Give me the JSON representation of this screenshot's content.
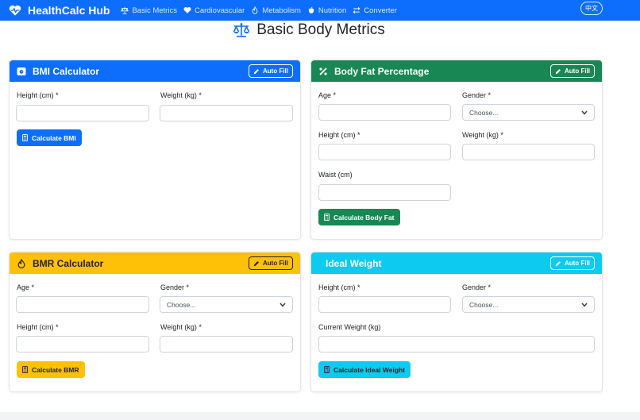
{
  "app": {
    "brand": "HealthCalc Hub",
    "lang_button": "中文"
  },
  "nav": [
    {
      "label": "Basic Metrics",
      "icon": "scale-icon"
    },
    {
      "label": "Cardiovascular",
      "icon": "heart-icon"
    },
    {
      "label": "Metabolism",
      "icon": "flame-icon"
    },
    {
      "label": "Nutrition",
      "icon": "apple-icon"
    },
    {
      "label": "Converter",
      "icon": "swap-icon"
    }
  ],
  "page": {
    "title": "Basic Body Metrics"
  },
  "colors": {
    "primary": "#0d6efd",
    "success": "#198754",
    "warning": "#ffc107",
    "info": "#0dcaf0"
  },
  "bmi": {
    "title": "BMI Calculator",
    "auto_fill": "Auto Fill",
    "height_label": "Height (cm) *",
    "weight_label": "Weight (kg) *",
    "height_value": "",
    "weight_value": "",
    "button": "Calculate BMI"
  },
  "bodyfat": {
    "title": "Body Fat Percentage",
    "auto_fill": "Auto Fill",
    "age_label": "Age *",
    "gender_label": "Gender *",
    "gender_value": "Choose...",
    "height_label": "Height (cm) *",
    "weight_label": "Weight (kg) *",
    "waist_label": "Waist (cm)",
    "button": "Calculate Body Fat"
  },
  "bmr": {
    "title": "BMR Calculator",
    "auto_fill": "Auto Fill",
    "age_label": "Age *",
    "gender_label": "Gender *",
    "gender_value": "Choose...",
    "height_label": "Height (cm) *",
    "weight_label": "Weight (kg) *",
    "button": "Calculate BMR"
  },
  "ideal": {
    "title": "Ideal Weight",
    "auto_fill": "Auto Fill",
    "height_label": "Height (cm) *",
    "gender_label": "Gender *",
    "gender_value": "Choose...",
    "current_weight_label": "Current Weight (kg)",
    "button": "Calculate Ideal Weight"
  }
}
